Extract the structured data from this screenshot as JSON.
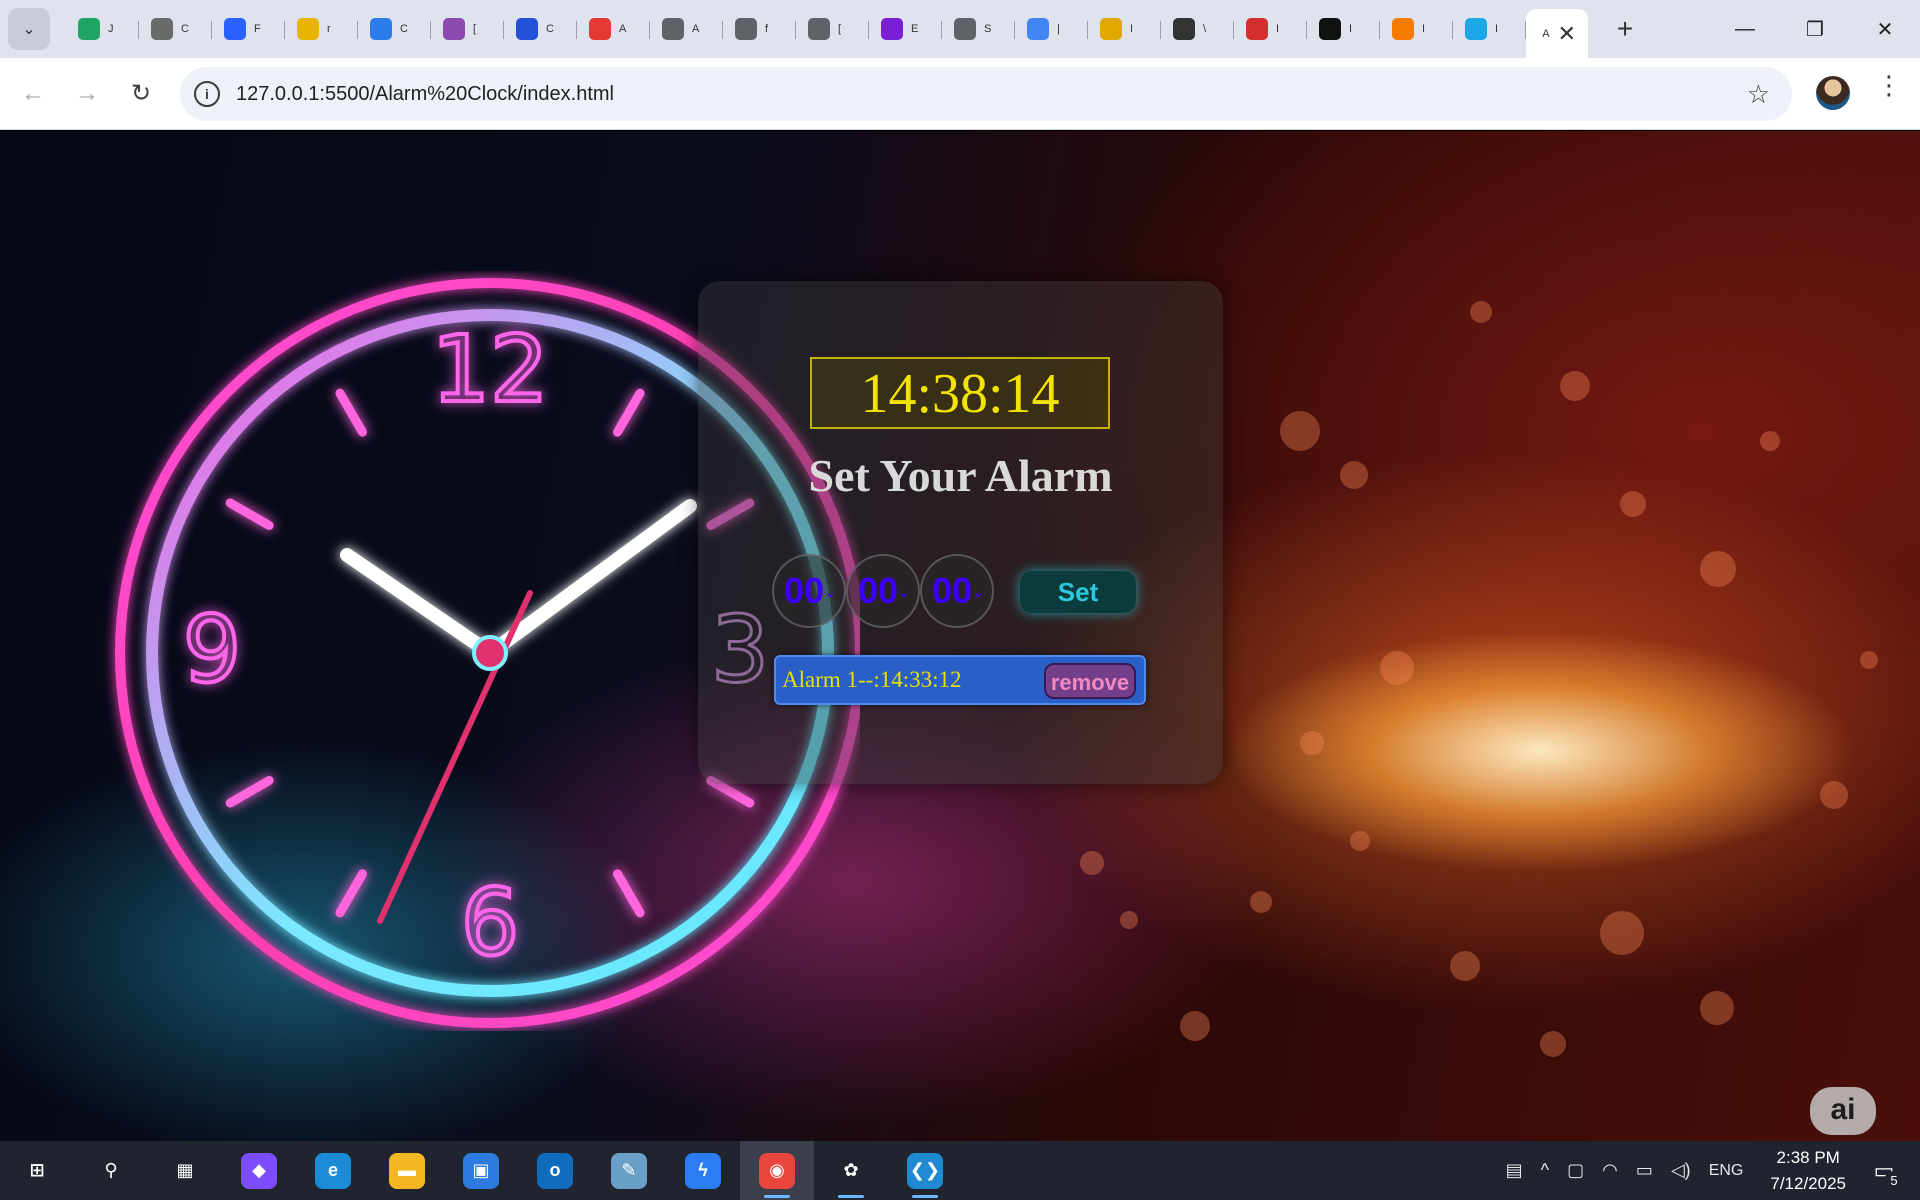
{
  "browser": {
    "tabs": [
      {
        "icon": "google-drive-icon",
        "title": "J",
        "color": "#1fa463"
      },
      {
        "icon": "bird-icon",
        "title": "C",
        "color": "#6a6a6a"
      },
      {
        "icon": "hashnode-icon",
        "title": "F",
        "color": "#2962ff"
      },
      {
        "icon": "emoji-icon",
        "title": "r",
        "color": "#e8b400"
      },
      {
        "icon": "docs-icon",
        "title": "C",
        "color": "#2b7de9"
      },
      {
        "icon": "avatar-icon",
        "title": "[",
        "color": "#8a4ab0"
      },
      {
        "icon": "flag-icon",
        "title": "C",
        "color": "#2450d6"
      },
      {
        "icon": "record-icon",
        "title": "A",
        "color": "#e53935"
      },
      {
        "icon": "globe-icon",
        "title": "A",
        "color": "#5f6368"
      },
      {
        "icon": "globe-icon",
        "title": "f",
        "color": "#5f6368"
      },
      {
        "icon": "globe-icon",
        "title": "[",
        "color": "#5f6368"
      },
      {
        "icon": "bootstrap-icon",
        "title": "E",
        "color": "#7a1fd6"
      },
      {
        "icon": "globe-icon",
        "title": "S",
        "color": "#5f6368"
      },
      {
        "icon": "google-icon",
        "title": "|",
        "color": "#4285f4"
      },
      {
        "icon": "book-icon",
        "title": "I",
        "color": "#e0a800"
      },
      {
        "icon": "spy-icon",
        "title": "\\",
        "color": "#333333"
      },
      {
        "icon": "gauge-icon",
        "title": "I",
        "color": "#d32f2f"
      },
      {
        "icon": "github-icon",
        "title": "I",
        "color": "#111111"
      },
      {
        "icon": "blogger-icon",
        "title": "I",
        "color": "#f57c00"
      },
      {
        "icon": "window-icon",
        "title": "I",
        "color": "#1ea7e8"
      }
    ],
    "active_tab_title": "A",
    "url": "127.0.0.1:5500/Alarm%20Clock/index.html"
  },
  "clock_face": {
    "numerals": [
      "12",
      "3",
      "6",
      "9"
    ]
  },
  "alarm_app": {
    "current_time": "14:38:14",
    "heading": "Set Your Alarm",
    "hour": "00",
    "minute": "00",
    "second": "00",
    "set_label": "Set",
    "alarms": [
      {
        "text": "Alarm 1--:14:33:12",
        "remove_label": "remove"
      }
    ]
  },
  "ai_badge": "ai",
  "taskbar": {
    "apps": [
      {
        "name": "start-icon",
        "glyph": "⊞",
        "color": "transparent"
      },
      {
        "name": "search-icon",
        "glyph": "⚲",
        "color": "transparent"
      },
      {
        "name": "task-view-icon",
        "glyph": "▦",
        "color": "transparent"
      },
      {
        "name": "copilot-icon",
        "glyph": "◆",
        "color": "#7c4dff"
      },
      {
        "name": "edge-icon",
        "glyph": "e",
        "color": "#1b8bd6"
      },
      {
        "name": "file-explorer-icon",
        "glyph": "▬",
        "color": "#f3b821"
      },
      {
        "name": "store-icon",
        "glyph": "▣",
        "color": "#2e7be0"
      },
      {
        "name": "outlook-icon",
        "glyph": "o",
        "color": "#0f6cbd"
      },
      {
        "name": "notepad-icon",
        "glyph": "✎",
        "color": "#6aa0c8"
      },
      {
        "name": "messenger-icon",
        "glyph": "ϟ",
        "color": "#2c7cf6"
      },
      {
        "name": "chrome-icon",
        "glyph": "◉",
        "color": "#e8453c"
      },
      {
        "name": "chatgpt-icon",
        "glyph": "✿",
        "color": "transparent"
      },
      {
        "name": "vscode-icon",
        "glyph": "❮❯",
        "color": "#1f8ad2"
      }
    ],
    "tray": {
      "language": "ENG",
      "time": "2:38 PM",
      "date": "7/12/2025",
      "notifications": "5"
    }
  }
}
